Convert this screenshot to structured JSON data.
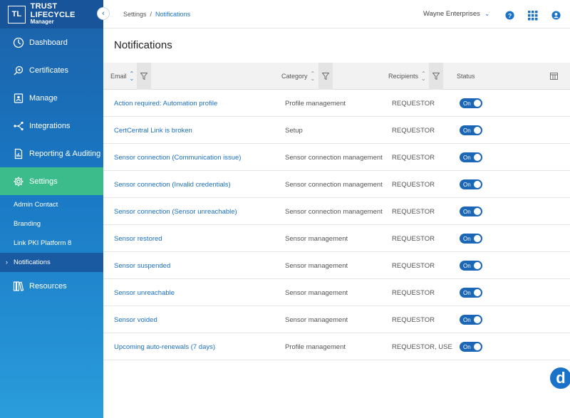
{
  "brand": {
    "logo": "TL",
    "title": "TRUST LIFECYCLE",
    "subtitle": "Manager"
  },
  "sidebar": {
    "items": [
      {
        "label": "Dashboard",
        "icon": "dashboard-icon"
      },
      {
        "label": "Certificates",
        "icon": "certificate-icon"
      },
      {
        "label": "Manage",
        "icon": "manage-icon"
      },
      {
        "label": "Integrations",
        "icon": "integrations-icon"
      },
      {
        "label": "Reporting & Auditing",
        "icon": "reporting-icon"
      },
      {
        "label": "Settings",
        "icon": "gear-icon",
        "active": true
      }
    ],
    "sub_items": [
      {
        "label": "Admin Contact"
      },
      {
        "label": "Branding"
      },
      {
        "label": "Link PKI Platform 8"
      },
      {
        "label": "Notifications",
        "current": true
      }
    ],
    "resources": {
      "label": "Resources",
      "icon": "books-icon"
    }
  },
  "header": {
    "breadcrumb": [
      "Settings",
      "Notifications"
    ],
    "breadcrumb_sep": "/",
    "org": "Wayne Enterprises"
  },
  "page": {
    "title": "Notifications"
  },
  "table": {
    "columns": {
      "email": "Email",
      "category": "Category",
      "recipients": "Recipients",
      "status": "Status"
    },
    "rows": [
      {
        "email": "Action required: Automation profile",
        "category": "Profile management",
        "recipients": "REQUESTOR",
        "status": "On"
      },
      {
        "email": "CertCentral Link is broken",
        "category": "Setup",
        "recipients": "REQUESTOR",
        "status": "On"
      },
      {
        "email": "Sensor connection (Communication issue)",
        "category": "Sensor connection management",
        "recipients": "REQUESTOR",
        "status": "On"
      },
      {
        "email": "Sensor connection (Invalid credentials)",
        "category": "Sensor connection management",
        "recipients": "REQUESTOR",
        "status": "On"
      },
      {
        "email": "Sensor connection (Sensor unreachable)",
        "category": "Sensor connection management",
        "recipients": "REQUESTOR",
        "status": "On"
      },
      {
        "email": "Sensor restored",
        "category": "Sensor management",
        "recipients": "REQUESTOR",
        "status": "On"
      },
      {
        "email": "Sensor suspended",
        "category": "Sensor management",
        "recipients": "REQUESTOR",
        "status": "On"
      },
      {
        "email": "Sensor unreachable",
        "category": "Sensor management",
        "recipients": "REQUESTOR",
        "status": "On"
      },
      {
        "email": "Sensor voided",
        "category": "Sensor management",
        "recipients": "REQUESTOR",
        "status": "On"
      },
      {
        "email": "Upcoming auto-renewals (7 days)",
        "category": "Profile management",
        "recipients": "REQUESTOR, USE",
        "status": "On"
      }
    ]
  },
  "fab": {
    "label": "d"
  },
  "colors": {
    "accent": "#1a73c8",
    "active_nav": "#3cbc8a",
    "toggle_on": "#1b66b5"
  }
}
